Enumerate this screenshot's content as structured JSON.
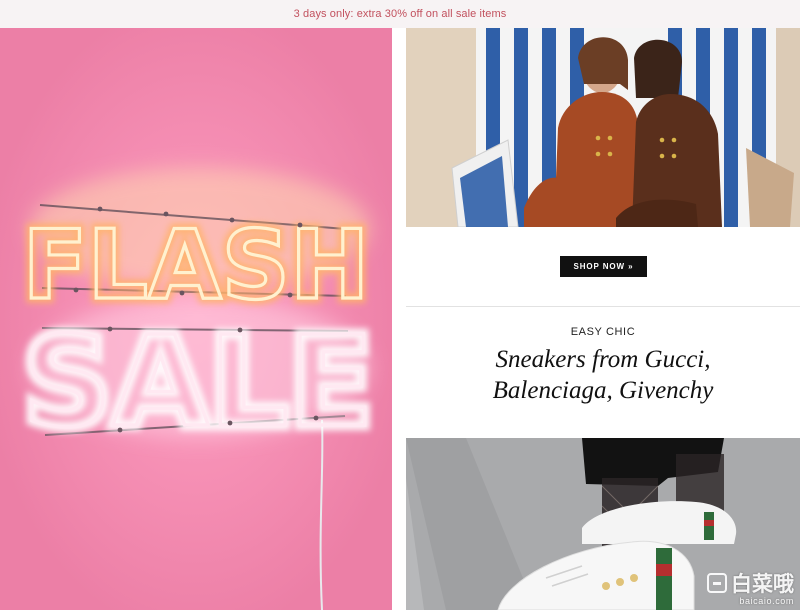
{
  "colors": {
    "promo_text": "#c2515e",
    "hero_pink": "#ec7fa6",
    "button_bg": "#111111"
  },
  "promo": {
    "text": "3 days only: extra 30% off on all sale items"
  },
  "hero": {
    "sign_lines": [
      "FLASH",
      "SALE"
    ]
  },
  "feature": {
    "cta_label": "SHOP NOW »"
  },
  "editorial": {
    "kicker": "EASY CHIC",
    "headline_line1": "Sneakers from Gucci,",
    "headline_line2": "Balenciaga, Givenchy"
  },
  "watermark": {
    "brand": "白菜哦",
    "url": "baicaio.com"
  },
  "icons": {
    "watermark_logo": "baicaio-logo-icon"
  }
}
